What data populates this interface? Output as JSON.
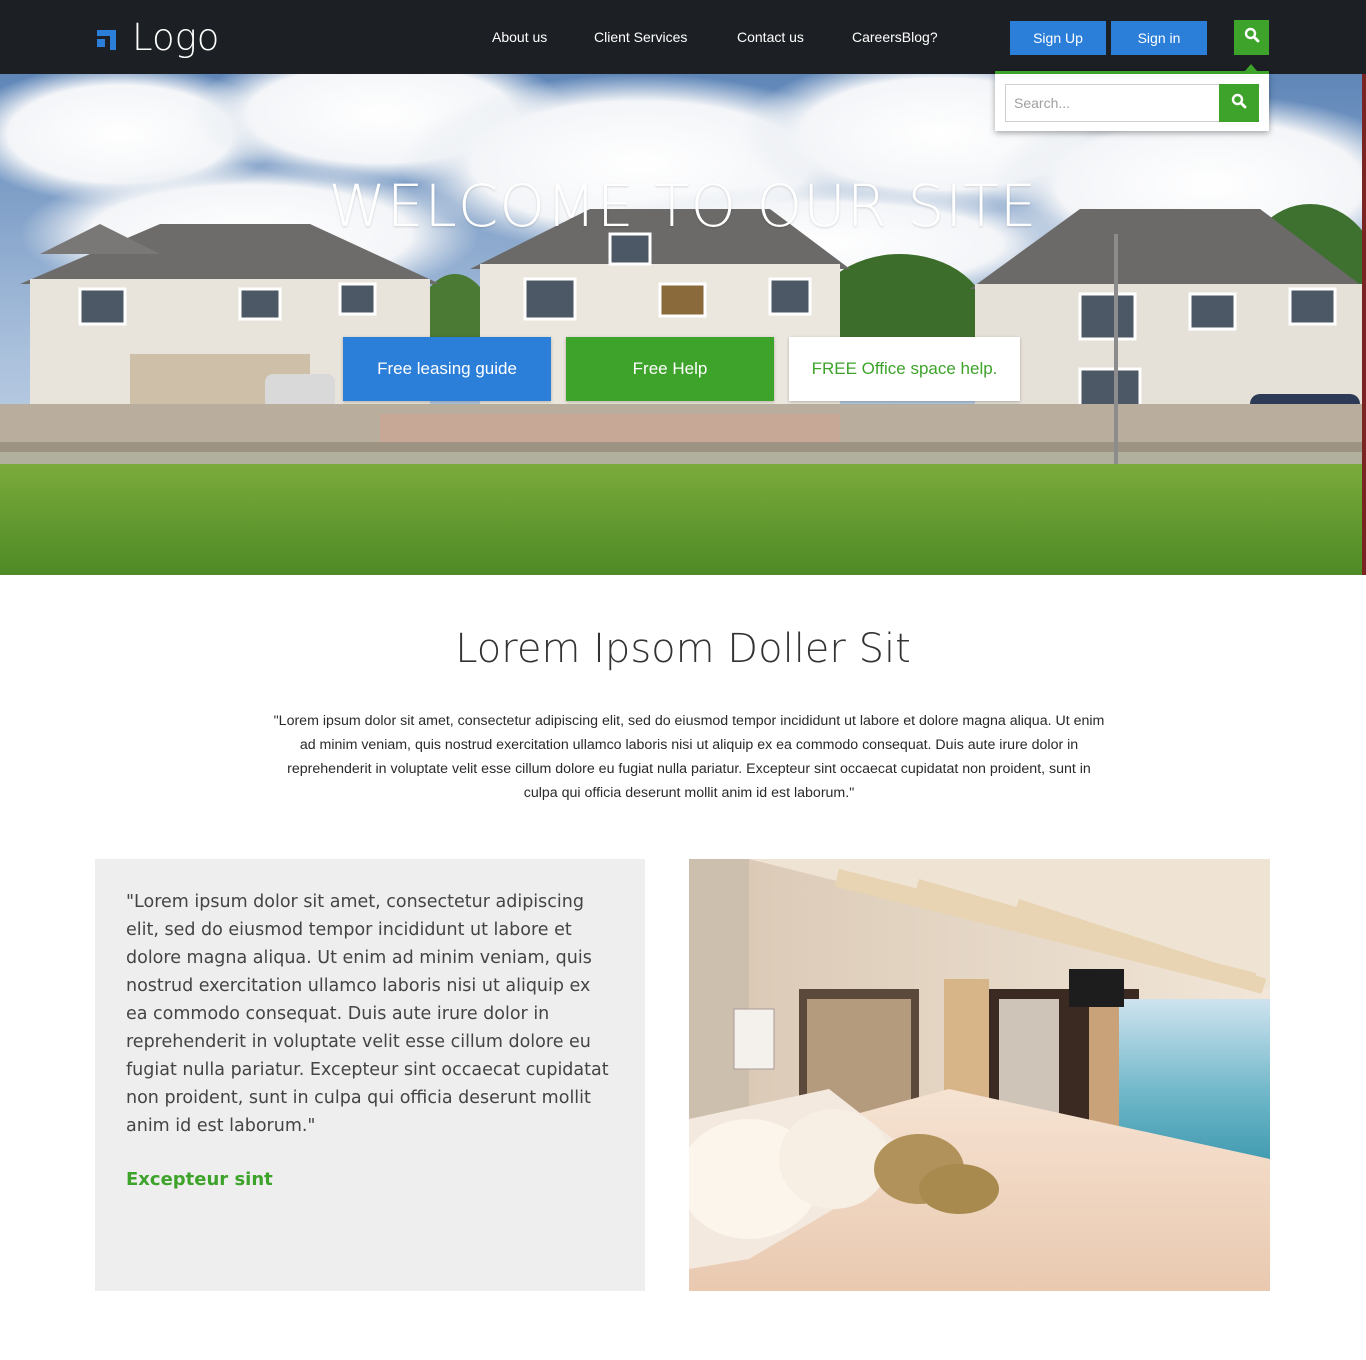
{
  "header": {
    "logo_text": "Logo",
    "nav": [
      {
        "label": "About us"
      },
      {
        "label": "Client Services"
      },
      {
        "label": "Contact us"
      },
      {
        "label": "CareersBlog?"
      }
    ],
    "signup_label": "Sign Up",
    "signin_label": "Sign in"
  },
  "search": {
    "placeholder": "Search..."
  },
  "hero": {
    "title": "WELCOME TO OUR SITE",
    "cta_primary": "Free leasing guide",
    "cta_secondary": "Free Help",
    "cta_tertiary": "FREE Office space help."
  },
  "intro": {
    "heading": "Lorem Ipsom Doller Sit",
    "text": "\"Lorem ipsum dolor sit amet, consectetur adipiscing elit, sed do eiusmod tempor incididunt ut labore et dolore magna aliqua. Ut enim ad minim veniam, quis nostrud exercitation ullamco laboris nisi ut aliquip ex ea commodo consequat. Duis aute irure dolor in reprehenderit in voluptate velit esse cillum dolore eu fugiat nulla pariatur. Excepteur sint occaecat cupidatat non proident, sunt in culpa qui officia deserunt mollit anim id est laborum.\""
  },
  "feature": {
    "quote": "\"Lorem ipsum dolor sit amet, consectetur adipiscing elit, sed do eiusmod tempor incididunt ut labore et dolore magna aliqua. Ut enim ad minim veniam, quis nostrud exercitation ullamco laboris nisi ut aliquip ex ea commodo consequat. Duis aute irure dolor in reprehenderit in voluptate velit esse cillum dolore eu fugiat nulla pariatur. Excepteur sint occaecat cupidatat non proident, sunt in culpa qui officia deserunt mollit anim id est laborum.\"",
    "link_label": "Excepteur sint"
  },
  "icons": {
    "logo": "logo-mark-icon",
    "search": "search-icon"
  },
  "colors": {
    "header_bg": "#1c1f23",
    "primary_blue": "#2b7fd9",
    "accent_green": "#3ea32b",
    "feature_bg": "#eeeeee"
  }
}
